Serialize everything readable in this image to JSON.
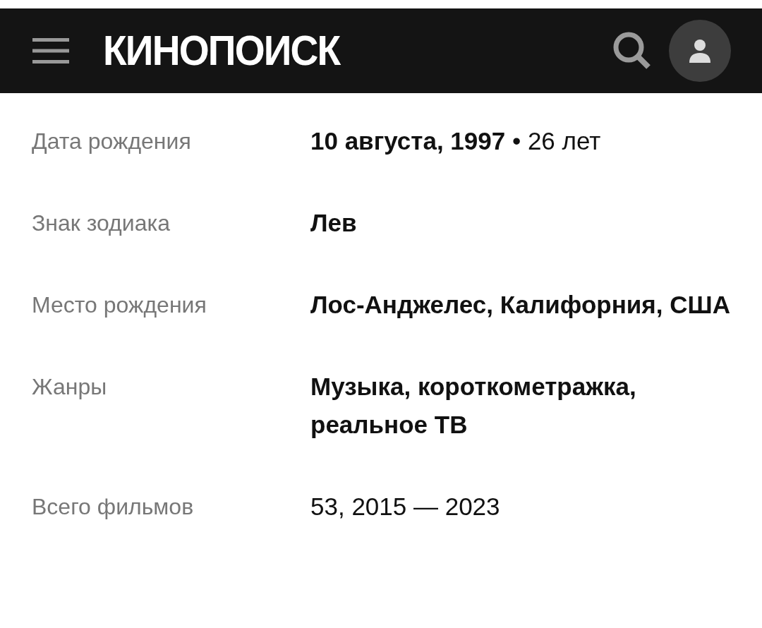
{
  "header": {
    "logo": "КИНОПОИСК"
  },
  "facts": [
    {
      "label": "Дата рождения",
      "value": "**10 августа, 1997** • 26 лет"
    },
    {
      "label": "Знак зодиака",
      "value": "**Лев**"
    },
    {
      "label": "Место рождения",
      "value": "**Лос-Анджелес, Калифорния, США**"
    },
    {
      "label": "Жанры",
      "value": "**Музыка, короткометражка, реальное ТВ**"
    },
    {
      "label": "Всего фильмов",
      "value": "53, 2015 — 2023"
    }
  ]
}
